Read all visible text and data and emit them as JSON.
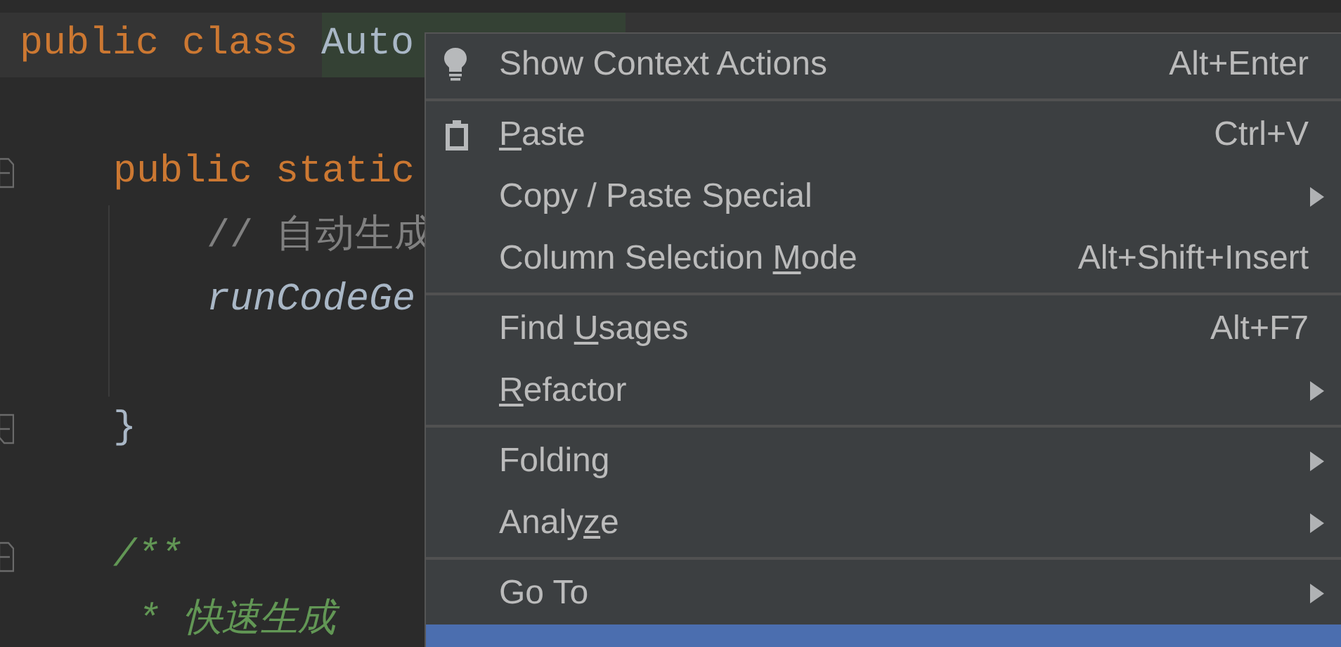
{
  "editor": {
    "lines": [
      {
        "current": true,
        "blank_after": true,
        "tokens": [
          {
            "text": "public class ",
            "kind": "keyword"
          },
          {
            "text": "Auto",
            "kind": "selected_identifier"
          }
        ],
        "children": [
          {
            "kind": "foldstart",
            "tokens": [
              {
                "text": "public static",
                "kind": "keyword"
              }
            ],
            "children": [
              {
                "kind": "guide",
                "tokens": [
                  {
                    "text": "// 自动生成",
                    "kind": "comment"
                  }
                ]
              },
              {
                "kind": "guide",
                "tokens": [
                  {
                    "text": "runCodeGe",
                    "kind": "static_call"
                  }
                ]
              },
              {
                "kind": "guide"
              }
            ]
          },
          {
            "kind": "foldend",
            "blank_after": true,
            "tokens": [
              {
                "text": "}",
                "kind": "brace"
              }
            ]
          },
          {
            "kind": "foldstart",
            "tokens": [
              {
                "text": "/**",
                "kind": "doc"
              }
            ]
          },
          {
            "kind": "docbody",
            "tokens": [
              {
                "text": "* 快速生成",
                "kind": "doc"
              }
            ]
          }
        ]
      }
    ]
  },
  "context_menu": {
    "groups": [
      {
        "items": [
          {
            "label": {
              "text": "Show Context Actions"
            },
            "shortcut": "Alt+Enter",
            "submenu": false,
            "selected": false
          }
        ]
      },
      {
        "items": [
          {
            "label": {
              "key": "P",
              "after": "aste"
            },
            "shortcut": "Ctrl+V",
            "submenu": false,
            "selected": false
          },
          {
            "label": {
              "text": "Copy / Paste Special"
            },
            "submenu": true,
            "selected": false
          },
          {
            "label": {
              "before": "Column Selection ",
              "key": "M",
              "after": "ode"
            },
            "shortcut": "Alt+Shift+Insert",
            "submenu": false,
            "selected": false
          }
        ]
      },
      {
        "items": [
          {
            "label": {
              "before": "Find ",
              "key": "U",
              "after": "sages"
            },
            "shortcut": "Alt+F7",
            "submenu": false,
            "selected": false
          },
          {
            "label": {
              "key": "R",
              "after": "efactor"
            },
            "submenu": true,
            "selected": false
          }
        ]
      },
      {
        "items": [
          {
            "label": {
              "text": "Folding"
            },
            "submenu": true,
            "selected": false
          },
          {
            "label": {
              "before": "Analy",
              "key": "z",
              "after": "e"
            },
            "submenu": true,
            "selected": false
          }
        ]
      },
      {
        "items": [
          {
            "label": {
              "text": "Go To"
            },
            "submenu": true,
            "selected": false
          },
          {
            "selected": true
          }
        ]
      }
    ]
  }
}
